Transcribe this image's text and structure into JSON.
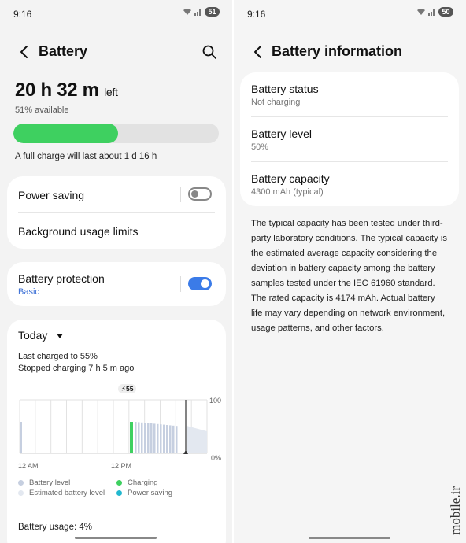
{
  "left": {
    "status_time": "9:16",
    "status_battery": "51",
    "title": "Battery",
    "time_left_main": "20 h 32 m",
    "time_left_suffix": "left",
    "available": "51% available",
    "battery_percent": 51,
    "full_charge": "A full charge will last about 1 d 16 h",
    "power_saving": "Power saving",
    "power_saving_on": false,
    "background_limits": "Background usage limits",
    "battery_protection": "Battery protection",
    "battery_protection_sub": "Basic",
    "battery_protection_on": true,
    "range_label": "Today",
    "last_charged": "Last charged to 55%",
    "stopped_charging": "Stopped charging 7 h 5 m ago",
    "charge_badge": "55",
    "axis_top": "100",
    "axis_bottom": "0%",
    "x_start": "12 AM",
    "x_mid": "12 PM",
    "legend": {
      "battery_level": "Battery level",
      "estimated": "Estimated battery level",
      "charging": "Charging",
      "power_saving": "Power saving"
    },
    "battery_usage": "Battery usage: 4%"
  },
  "right": {
    "status_time": "9:16",
    "status_battery": "50",
    "title": "Battery information",
    "rows": [
      {
        "title": "Battery status",
        "value": "Not charging"
      },
      {
        "title": "Battery level",
        "value": "50%"
      },
      {
        "title": "Battery capacity",
        "value": "4300 mAh (typical)"
      }
    ],
    "description": "The typical capacity has been tested under third-party laboratory conditions. The typical capacity is the estimated average capacity considering the deviation in battery capacity among the battery samples tested under the IEC 61960 standard. The rated capacity is 4174 mAh. Actual battery life may vary depending on network environment, usage patterns, and other factors."
  },
  "watermark": "mobile.ir",
  "colors": {
    "charge_green": "#3ed060",
    "toggle_blue": "#3b7be8",
    "battery_level": "#c6cfe0",
    "estimated": "#e3e8f0",
    "power_saving": "#22b8cf"
  }
}
